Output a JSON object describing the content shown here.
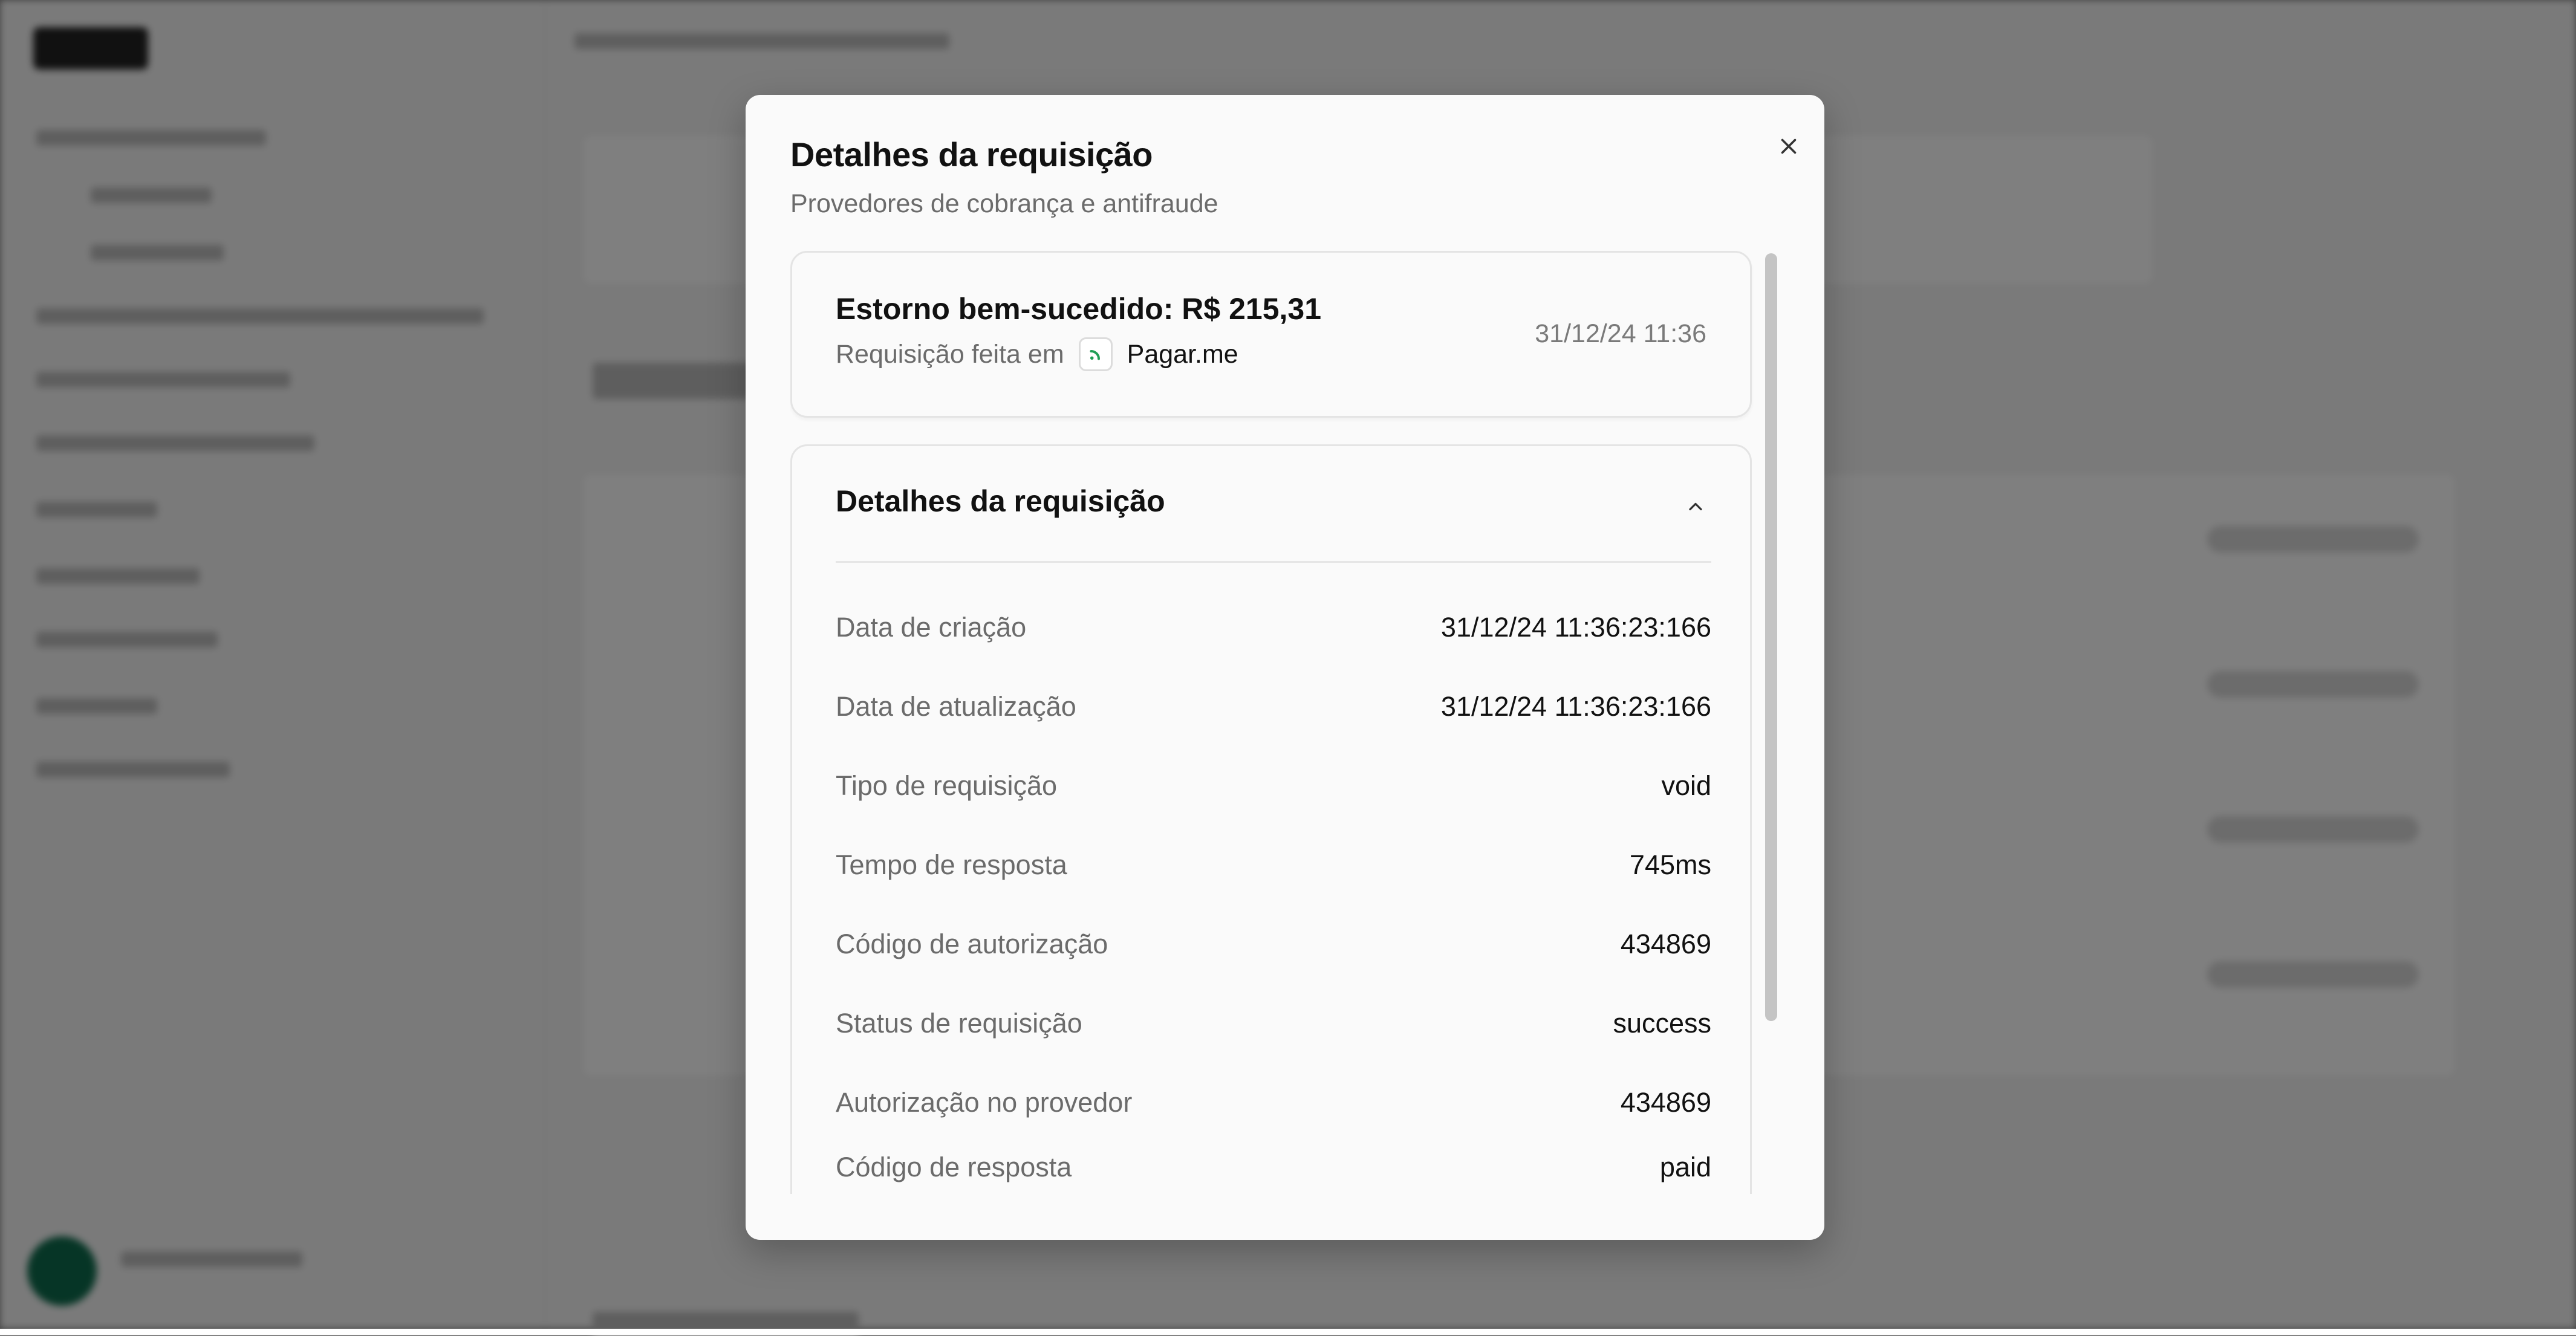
{
  "modal": {
    "title": "Detalhes da requisição",
    "subtitle": "Provedores de cobrança e antifraude",
    "close_icon": "close-icon"
  },
  "summary": {
    "title": "Estorno bem-sucedido: R$ 215,31",
    "request_made_in": "Requisição feita em",
    "provider_name": "Pagar.me",
    "provider_icon": "pagarme-logo-icon",
    "timestamp": "31/12/24 11:36"
  },
  "details": {
    "header": "Detalhes da requisição",
    "toggle_icon": "chevron-up-icon",
    "rows": [
      {
        "label": "Data de criação",
        "value": "31/12/24 11:36:23:166"
      },
      {
        "label": "Data de atualização",
        "value": "31/12/24 11:36:23:166"
      },
      {
        "label": "Tipo de requisição",
        "value": "void"
      },
      {
        "label": "Tempo de resposta",
        "value": "745ms"
      },
      {
        "label": "Código de autorização",
        "value": "434869"
      },
      {
        "label": "Status de requisição",
        "value": "success"
      },
      {
        "label": "Autorização no provedor",
        "value": "434869"
      },
      {
        "label": "Código de resposta",
        "value": "paid"
      }
    ]
  },
  "colors": {
    "overlay": "#808080",
    "modal_bg": "#fafafa",
    "provider_accent": "#1f9d55"
  }
}
